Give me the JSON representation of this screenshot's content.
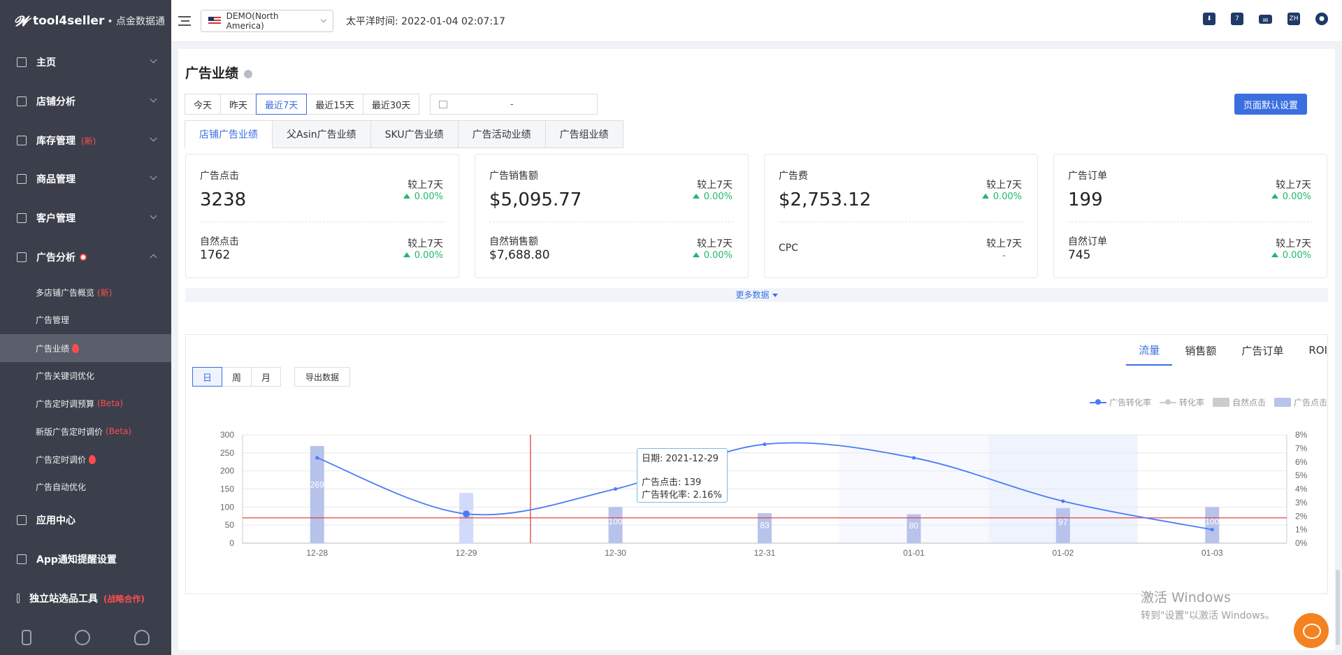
{
  "app": {
    "logo": "tool4seller",
    "logo_sub": "• 点金数据通"
  },
  "sidebar": {
    "items": [
      {
        "label": "主页",
        "tag": ""
      },
      {
        "label": "店铺分析",
        "tag": ""
      },
      {
        "label": "库存管理",
        "tag": "(新)"
      },
      {
        "label": "商品管理",
        "tag": ""
      },
      {
        "label": "客户管理",
        "tag": ""
      },
      {
        "label": "广告分析",
        "tag": ""
      },
      {
        "label": "应用中心",
        "tag": ""
      },
      {
        "label": "App通知提醒设置",
        "tag": ""
      },
      {
        "label": "独立站选品工具",
        "tag": "(战略合作)"
      }
    ],
    "ad_sub_items": [
      {
        "label": "多店铺广告概览",
        "tag": "(新)"
      },
      {
        "label": "广告管理",
        "tag": ""
      },
      {
        "label": "广告业绩",
        "tag": ""
      },
      {
        "label": "广告关键词优化",
        "tag": ""
      },
      {
        "label": "广告定时调预算",
        "tag": "(Beta)"
      },
      {
        "label": "新版广告定时调价",
        "tag": "(Beta)"
      },
      {
        "label": "广告定时调价",
        "tag": ""
      },
      {
        "label": "广告自动优化",
        "tag": ""
      }
    ]
  },
  "header": {
    "store": "DEMO(North America)",
    "pacific_time": "太平洋时间: 2022-01-04 02:07:17",
    "lang": "ZH",
    "calendar_day": "7"
  },
  "page": {
    "title": "广告业绩",
    "date_buttons": [
      "今天",
      "昨天",
      "最近7天",
      "最近15天",
      "最近30天"
    ],
    "date_range_sep": "-",
    "default_settings": "页面默认设置",
    "tabs": [
      "店铺广告业绩",
      "父Asin广告业绩",
      "SKU广告业绩",
      "广告活动业绩",
      "广告组业绩"
    ],
    "more_data": "更多数据"
  },
  "cards": [
    {
      "label": "广告点击",
      "value": "3238",
      "cmp": "较上7天",
      "pct": "0.00%",
      "sub_label": "自然点击",
      "sub_value": "1762",
      "sub_cmp": "较上7天",
      "sub_pct": "0.00%"
    },
    {
      "label": "广告销售额",
      "value": "$5,095.77",
      "cmp": "较上7天",
      "pct": "0.00%",
      "sub_label": "自然销售额",
      "sub_value": "$7,688.80",
      "sub_cmp": "较上7天",
      "sub_pct": "0.00%"
    },
    {
      "label": "广告费",
      "value": "$2,753.12",
      "cmp": "较上7天",
      "pct": "0.00%",
      "sub_label": "CPC",
      "sub_value": "",
      "sub_cmp": "较上7天",
      "sub_pct": "-"
    },
    {
      "label": "广告订单",
      "value": "199",
      "cmp": "较上7天",
      "pct": "0.00%",
      "sub_label": "自然订单",
      "sub_value": "745",
      "sub_cmp": "较上7天",
      "sub_pct": "0.00%"
    }
  ],
  "chart_panel": {
    "metric_tabs": [
      "流量",
      "销售额",
      "广告订单",
      "ROI"
    ],
    "period_buttons": [
      "日",
      "周",
      "月"
    ],
    "export": "导出数据",
    "legend": [
      {
        "name": "广告转化率",
        "color": "#4a7bf7",
        "kind": "line"
      },
      {
        "name": "转化率",
        "color": "#cccccc",
        "kind": "line"
      },
      {
        "name": "自然点击",
        "color": "#cccccc",
        "kind": "box"
      },
      {
        "name": "广告点击",
        "color": "#b8c3ec",
        "kind": "box"
      }
    ],
    "tooltip": {
      "date": "日期: 2021-12-29",
      "clicks": "广告点击: 139",
      "rate": "广告转化率: 2.16%"
    }
  },
  "chart_data": {
    "type": "bar",
    "categories": [
      "12-28",
      "12-29",
      "12-30",
      "12-31",
      "01-01",
      "01-02",
      "01-03"
    ],
    "series": [
      {
        "name": "广告点击",
        "type": "bar",
        "axis": "left",
        "values": [
          269,
          139,
          100,
          83,
          80,
          97,
          100
        ],
        "labels": [
          "269",
          "139",
          "100",
          "83",
          "80",
          "97",
          "100"
        ]
      },
      {
        "name": "广告转化率",
        "type": "line",
        "axis": "right",
        "unit": "%",
        "values": [
          6.3,
          2.16,
          4.0,
          7.3,
          6.3,
          3.1,
          1.0
        ]
      }
    ],
    "ylim": [
      0,
      300
    ],
    "yticks": [
      0,
      50,
      100,
      150,
      200,
      250,
      300
    ],
    "y2lim": [
      0,
      8
    ],
    "y2ticks": [
      "0%",
      "1%",
      "2%",
      "3%",
      "4%",
      "5%",
      "6%",
      "7%",
      "8%"
    ],
    "reference_line": 70,
    "highlight_category": "12-29",
    "legend_position": "top-right",
    "grid": true
  },
  "watermark": {
    "line1": "激活 Windows",
    "line2": "转到\"设置\"以激活 Windows。"
  },
  "colors": {
    "accent": "#3b6fe0",
    "sidebar": "#3a3f4b",
    "up": "#1fb86b",
    "alert": "#ff4d4f"
  }
}
